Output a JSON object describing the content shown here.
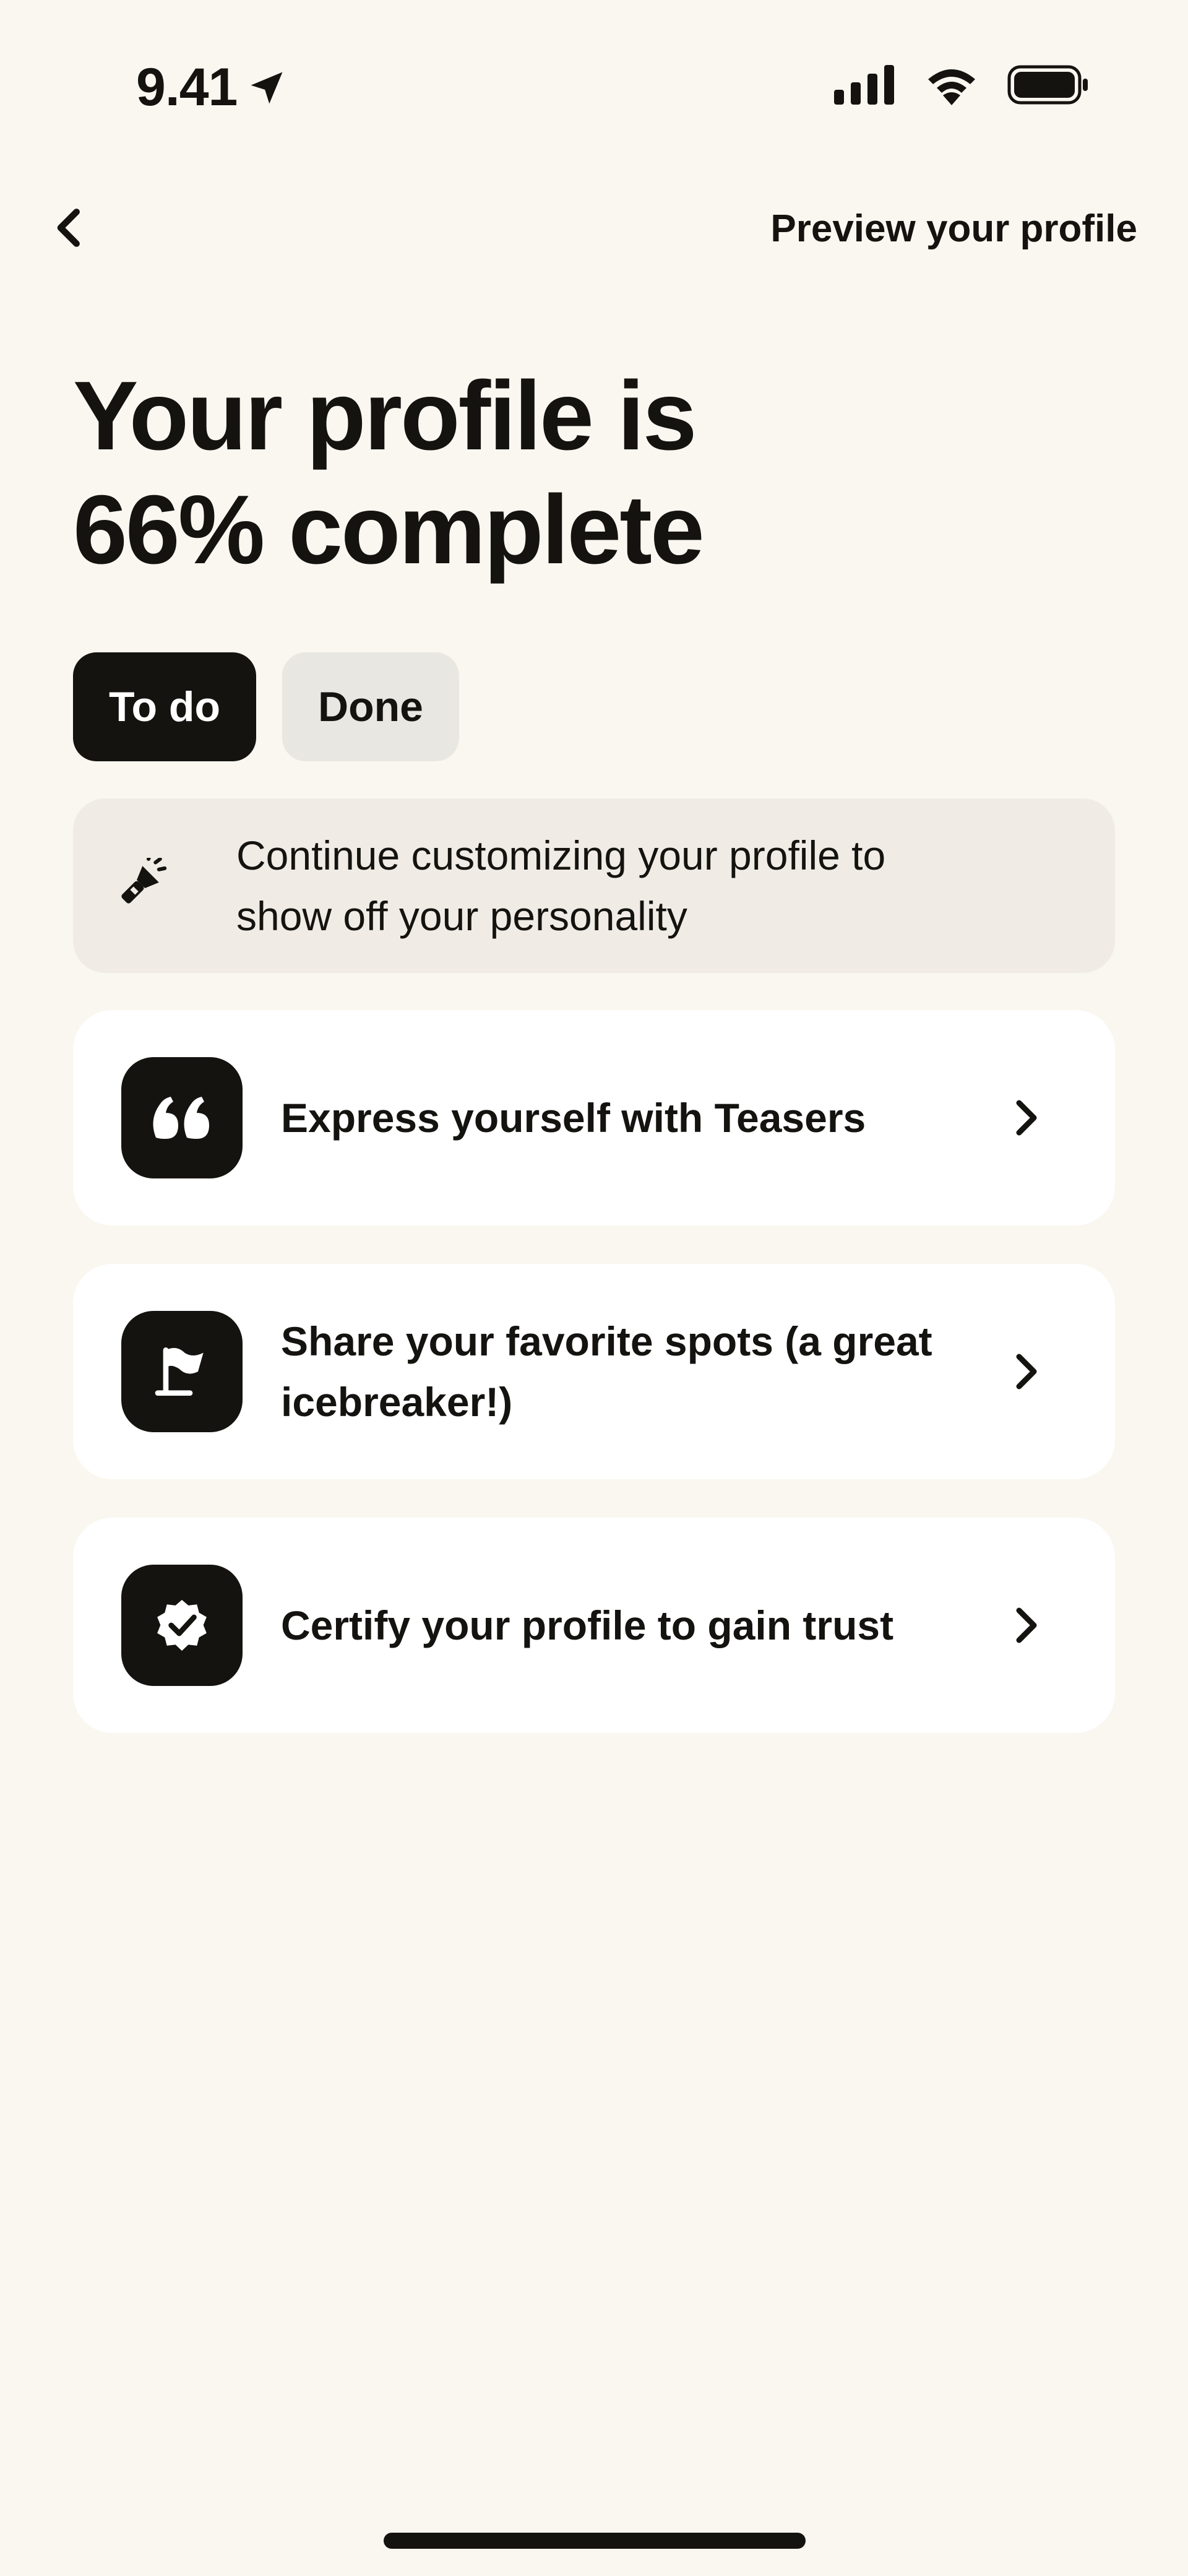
{
  "status_bar": {
    "time": "9.41"
  },
  "nav": {
    "back_icon": "chevron-left-icon",
    "preview_label": "Preview your profile"
  },
  "title": {
    "line1": "Your profile is",
    "line2": "66% complete"
  },
  "progress": {
    "complete_percent": 66
  },
  "tabs": [
    {
      "label": "To do",
      "active": true
    },
    {
      "label": "Done",
      "active": false
    }
  ],
  "info_banner": {
    "icon": "flashlight-icon",
    "text": "Continue customizing your profile to show off your personality"
  },
  "tasks": [
    {
      "icon": "quote-icon",
      "label": "Express yourself with Teasers"
    },
    {
      "icon": "flag-icon",
      "label": "Share your favorite spots (a great icebreaker!)"
    },
    {
      "icon": "verified-badge-icon",
      "label": "Certify your profile to gain trust"
    }
  ],
  "colors": {
    "background": "#FAF7F0",
    "primary": "#141310",
    "card": "#FFFFFF",
    "banner": "#F0ECE5",
    "tab_inactive": "#E9E7E1"
  }
}
